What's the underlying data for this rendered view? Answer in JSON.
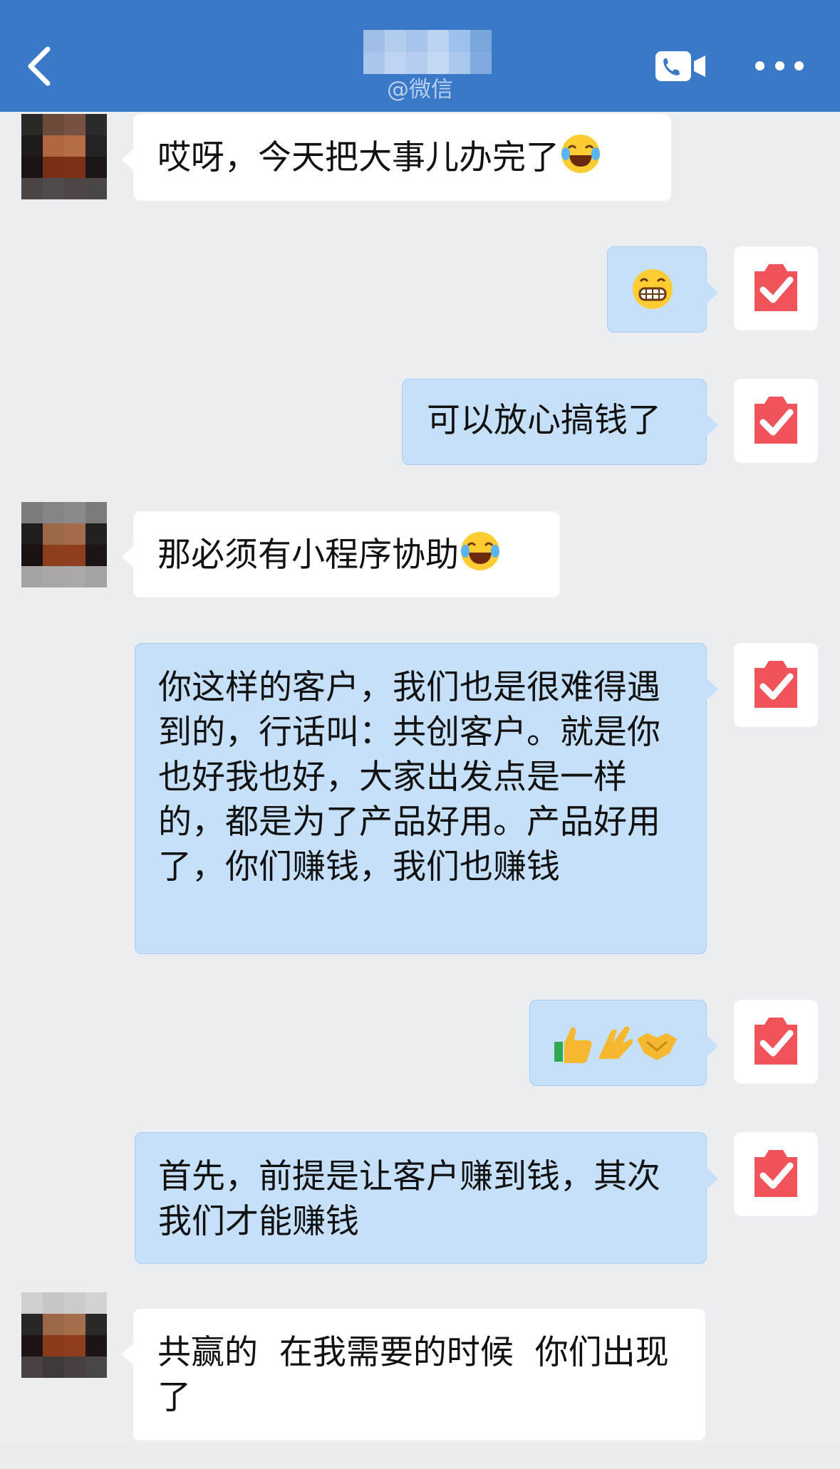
{
  "header": {
    "back_icon": "chevron-left-icon",
    "contact_name_blurred": true,
    "subtitle": "@微信",
    "video_call_icon": "phone-video-icon",
    "more_icon": "more-dots-icon"
  },
  "colors": {
    "header": "#3a78c8",
    "incoming_bubble": "#ffffff",
    "outgoing_bubble": "#c5e0f8",
    "self_avatar_red": "#f0545a",
    "background": "#ebedf0"
  },
  "messages": [
    {
      "side": "in",
      "text": "哎呀，今天把大事儿办完了",
      "emoji": "tears-of-joy-emoji"
    },
    {
      "side": "out",
      "text": "",
      "emoji": "grinning-emoji"
    },
    {
      "side": "out",
      "text": "可以放心搞钱了"
    },
    {
      "side": "in",
      "text": "那必须有小程序协助",
      "emoji": "tears-of-joy-emoji"
    },
    {
      "side": "out",
      "text": "你这样的客户，我们也是很难得遇到的，行话叫：共创客户。就是你也好我也好，大家出发点是一样的，都是为了产品好用。产品好用了，你们赚钱，我们也赚钱"
    },
    {
      "side": "out",
      "text": "",
      "emojis": [
        "thumbs-up-emoji",
        "ok-hand-emoji",
        "handshake-emoji"
      ]
    },
    {
      "side": "out",
      "text": "首先，前提是让客户赚到钱，其次我们才能赚钱"
    },
    {
      "side": "in",
      "text": "共赢的  在我需要的时候  你们出现了"
    }
  ]
}
